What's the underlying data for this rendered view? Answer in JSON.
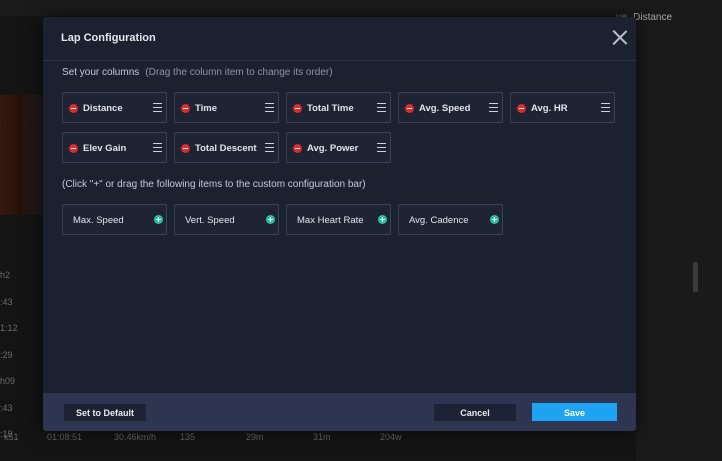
{
  "background": {
    "tabs": [
      "ue",
      "Distance"
    ],
    "times": [
      "h2",
      ":43",
      "1:12",
      ":29",
      "h09",
      ":43",
      ":19"
    ],
    "bottom_row": [
      "k51",
      "01:08:51",
      "30.46km/h",
      "135",
      "29m",
      "31m",
      "204w"
    ]
  },
  "modal": {
    "title": "Lap Configuration",
    "columns_heading": "Set your columns",
    "columns_hint": "(Drag the column item to change its order)",
    "selected_columns": [
      {
        "label": "Distance"
      },
      {
        "label": "Time"
      },
      {
        "label": "Total Time"
      },
      {
        "label": "Avg. Speed"
      },
      {
        "label": "Avg. HR"
      },
      {
        "label": "Elev Gain"
      },
      {
        "label": "Total Descent"
      },
      {
        "label": "Avg. Power"
      }
    ],
    "available_hint": "(Click \"+\" or drag the following items to the custom configuration bar)",
    "available_columns": [
      {
        "label": "Max. Speed"
      },
      {
        "label": "Vert. Speed"
      },
      {
        "label": "Max Heart Rate"
      },
      {
        "label": "Avg. Cadence"
      }
    ],
    "footer": {
      "default_label": "Set to Default",
      "cancel_label": "Cancel",
      "save_label": "Save"
    }
  },
  "colors": {
    "accent": "#1ea3f3",
    "remove": "#e0282f",
    "add": "#26c2a8"
  }
}
